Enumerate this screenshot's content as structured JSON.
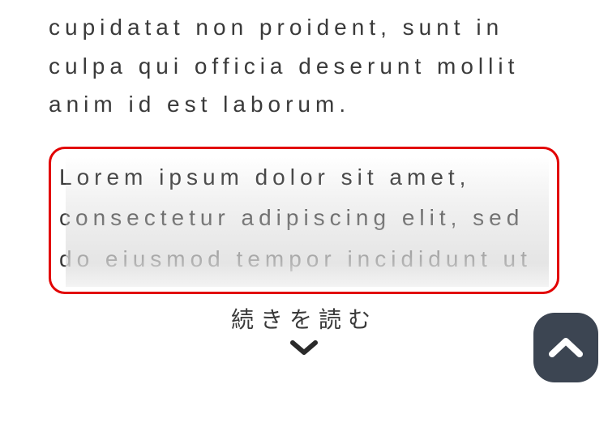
{
  "top_paragraph": "cupidatat non proident, sunt in culpa qui officia deserunt mollit anim id est laborum.",
  "teaser_paragraph": "Lorem ipsum dolor sit amet, consectetur adipiscing elit, sed do eiusmod tempor incididunt ut",
  "read_more_label": "続きを読む",
  "colors": {
    "highlight_border": "#e20000",
    "scroll_button": "#3c4552",
    "text": "#3a3a3a"
  },
  "icons": {
    "chevron_down": "chevron-down-icon",
    "chevron_up": "chevron-up-icon"
  }
}
